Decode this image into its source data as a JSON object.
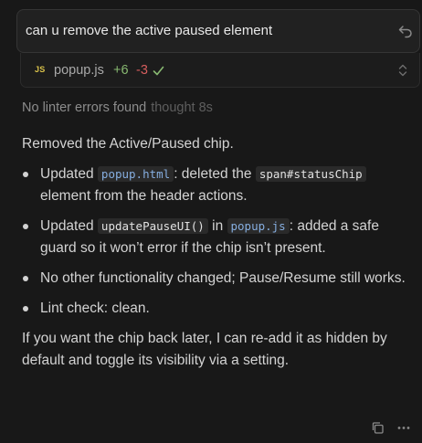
{
  "prompt": {
    "text": "can u remove the active paused element",
    "undo_icon": "undo-arrow-icon"
  },
  "file_change": {
    "badge": "JS",
    "file_name": "popup.js",
    "additions": "+6",
    "deletions": "-3",
    "status_icon": "check-icon",
    "expand_icon": "chevron-up-down-icon"
  },
  "status": {
    "lint": "No linter errors found",
    "thought": "thought 8s"
  },
  "response": {
    "intro": "Removed the Active/Paused chip.",
    "bullets": [
      {
        "t1": "Updated ",
        "c1": "popup.html",
        "t2": ": deleted the ",
        "c2": "span#statusChip",
        "t3": " element from the header actions."
      },
      {
        "t1": "Updated ",
        "c1": "updatePauseUI()",
        "t2": " in ",
        "c2": "popup.js",
        "t3": ": added a safe guard so it won’t error if the chip isn’t present."
      },
      {
        "t1": "No other functionality changed; Pause/Resume still works."
      },
      {
        "t1": "Lint check: clean."
      }
    ],
    "closing": "If you want the chip back later, I can re-add it as hidden by default and toggle its visibility via a setting."
  },
  "footer": {
    "copy_icon": "copy-icon",
    "more_icon": "more-icon"
  },
  "colors": {
    "background": "#181818",
    "addition": "#88b971",
    "deletion": "#d45d5d",
    "code_link": "#86aee0",
    "js_badge": "#d9c24a"
  }
}
